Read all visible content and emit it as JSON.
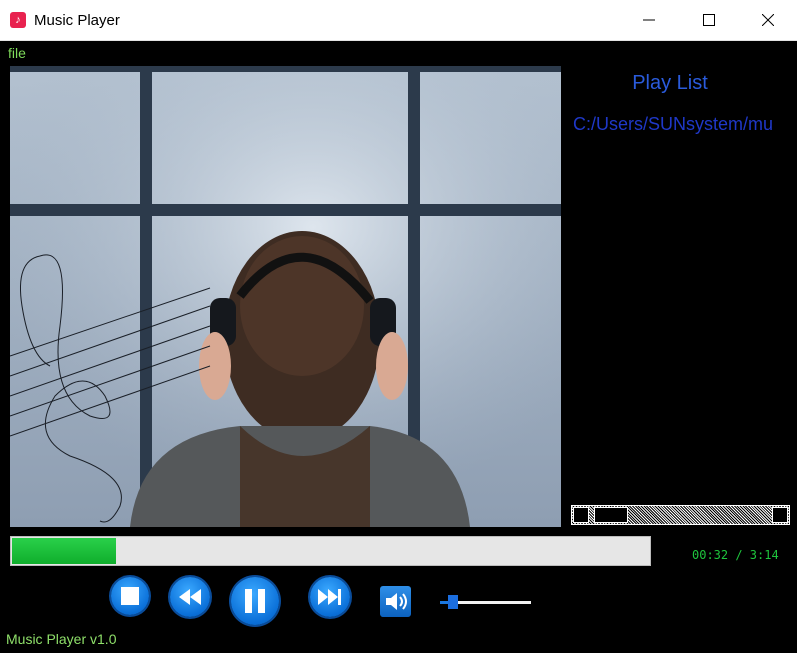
{
  "window": {
    "title": "Music Player",
    "app_icon": "music-note-icon",
    "controls": [
      "minimize-icon",
      "maximize-icon",
      "close-icon"
    ]
  },
  "menu": {
    "file_label": "file"
  },
  "album_art": {
    "description_icon": "album-art-image"
  },
  "playlist": {
    "title": "Play List",
    "items": [
      "C:/Users/SUNsystem/mu"
    ]
  },
  "playback": {
    "progress_fraction": 0.163,
    "elapsed": "00:32",
    "separator": " / ",
    "duration": "3:14",
    "time_display": "00:32 / 3:14"
  },
  "controls": {
    "stop_icon": "stop-icon",
    "rewind_icon": "rewind-icon",
    "pause_icon": "pause-icon",
    "fast_forward_icon": "fast-forward-icon",
    "volume_icon": "speaker-icon",
    "volume_fraction": 0.14
  },
  "status": {
    "text": "Music Player v1.0"
  },
  "colors": {
    "accent_green": "#1ec53d",
    "playlist_blue": "#2a5bdc",
    "button_blue": "#0a6fd8"
  }
}
